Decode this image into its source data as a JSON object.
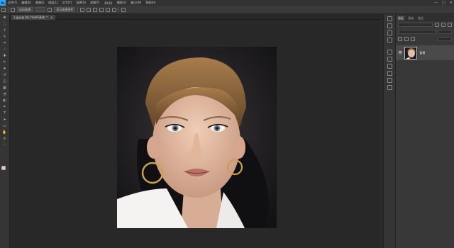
{
  "app": {
    "logo": "Ps"
  },
  "menu": [
    "文件(F)",
    "编辑(E)",
    "图像(I)",
    "图层(L)",
    "文字(Y)",
    "选择(S)",
    "滤镜(T)",
    "3D(D)",
    "视图(V)",
    "窗口(W)",
    "帮助(H)"
  ],
  "window_controls": [
    "—",
    "□",
    "✕"
  ],
  "options": {
    "auto_select": "自动选择:",
    "show_transform": "显示变换控件"
  },
  "document": {
    "tab_title": "1.jpg @ 66.7%(RGB/8) *",
    "close": "×"
  },
  "colors": {
    "foreground": "#f0c8c8",
    "background": "#ffffff",
    "accent": "#31a8ff"
  },
  "tools": [
    "move-icon",
    "marquee-icon",
    "lasso-icon",
    "quick-select-icon",
    "crop-icon",
    "eyedropper-icon",
    "healing-icon",
    "brush-icon",
    "stamp-icon",
    "history-brush-icon",
    "eraser-icon",
    "gradient-icon",
    "blur-icon",
    "dodge-icon",
    "pen-icon",
    "type-icon",
    "path-select-icon",
    "shape-icon",
    "hand-icon",
    "zoom-icon",
    "more-icon"
  ],
  "layers_panel": {
    "tabs": [
      "图层",
      "通道",
      "路径"
    ],
    "layers": [
      {
        "name": "背景",
        "visible": true
      }
    ]
  }
}
